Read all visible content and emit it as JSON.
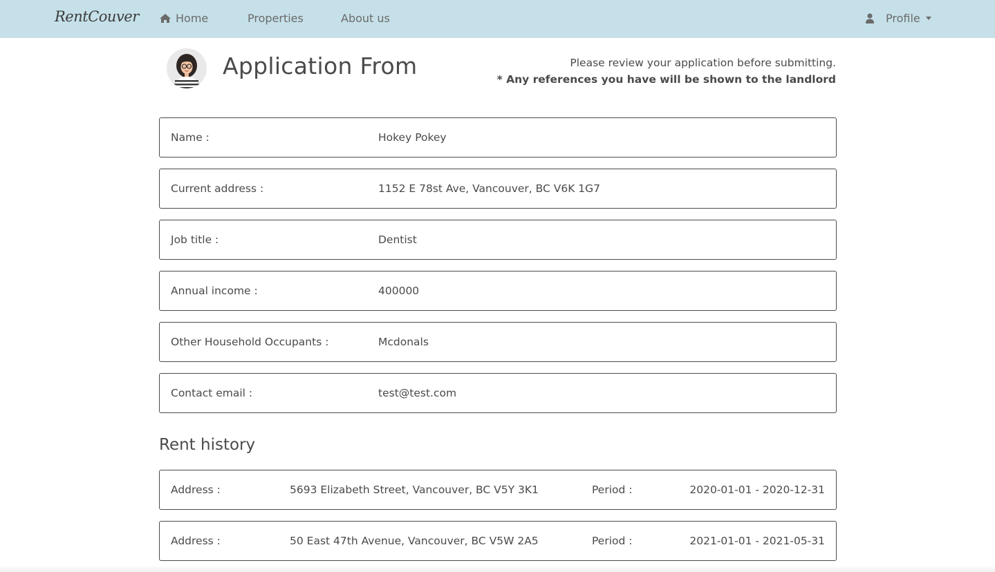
{
  "navbar": {
    "brand": "RentCouver",
    "home": "Home",
    "home_icon": "home-icon",
    "properties": "Properties",
    "about": "About us",
    "profile": "Profile",
    "profile_icon": "user-icon",
    "background": "#c5e0e8"
  },
  "header": {
    "title": "Application From",
    "review_note": "Please review your application before submitting.",
    "references_note": "* Any references you have will be shown to the landlord"
  },
  "fields": [
    {
      "label": "Name :",
      "value": "Hokey Pokey"
    },
    {
      "label": "Current address :",
      "value": "1152 E 78st Ave, Vancouver, BC V6K 1G7"
    },
    {
      "label": "Job title :",
      "value": "Dentist"
    },
    {
      "label": "Annual income :",
      "value": "400000"
    },
    {
      "label": "Other Household Occupants :",
      "value": "Mcdonals"
    },
    {
      "label": "Contact email :",
      "value": "test@test.com"
    }
  ],
  "rent_history": {
    "title": "Rent history",
    "rows": [
      {
        "address_label": "Address :",
        "address": "5693 Elizabeth Street, Vancouver, BC V5Y 3K1",
        "period_label": "Period :",
        "period": "2020-01-01 - 2020-12-31"
      },
      {
        "address_label": "Address :",
        "address": "50 East 47th Avenue, Vancouver, BC V5W 2A5",
        "period_label": "Period :",
        "period": "2021-01-01 - 2021-05-31"
      }
    ]
  }
}
